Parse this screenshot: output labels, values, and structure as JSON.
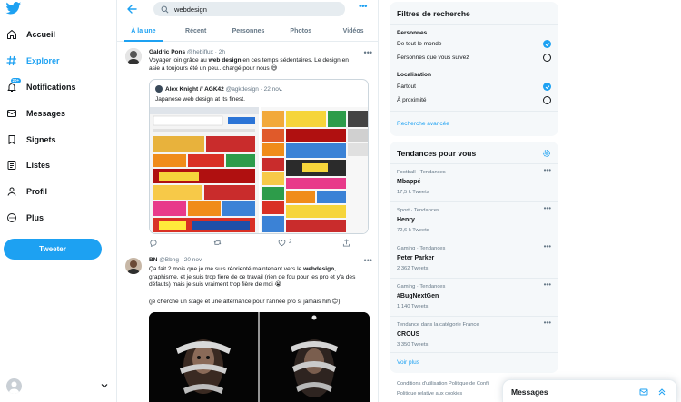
{
  "nav": {
    "items": [
      {
        "label": "Accueil",
        "icon": "home-icon"
      },
      {
        "label": "Explorer",
        "icon": "hash-icon"
      },
      {
        "label": "Notifications",
        "icon": "bell-icon",
        "badge": "20+"
      },
      {
        "label": "Messages",
        "icon": "envelope-icon"
      },
      {
        "label": "Signets",
        "icon": "bookmark-icon"
      },
      {
        "label": "Listes",
        "icon": "list-icon"
      },
      {
        "label": "Profil",
        "icon": "user-icon"
      },
      {
        "label": "Plus",
        "icon": "more-circle-icon"
      }
    ],
    "tweet_button": "Tweeter"
  },
  "search": {
    "value": "webdesign"
  },
  "tabs": [
    "À la une",
    "Récent",
    "Personnes",
    "Photos",
    "Vidéos"
  ],
  "tweets": [
    {
      "name": "Galdric Pons",
      "meta": "@hebiflux · 2h",
      "text_parts": [
        "Voyager loin grâce au ",
        "web design",
        " en ces temps sédentaires. Le design en asie a toujours été un peu.. chargé pour nous 😅"
      ],
      "quote": {
        "name": "Alex Knight // AGK42",
        "meta": "@agkdesign · 22 nov.",
        "text": "Japanese web design at its finest."
      },
      "actions": {
        "reply": "",
        "retweet": "",
        "like": "2"
      }
    },
    {
      "name": "BN",
      "meta": "@Bbng · 20 nov.",
      "text_parts": [
        "Ça fait 2 mois que je me suis réorienté maintenant vers le ",
        "webdesign",
        ", graphisme, et je suis trop fière de ce travail (rien de fou pour les pro et y'a des défauts) mais je suis vraiment trop fière de moi 😭"
      ],
      "text2": "(je cherche un stage et une alternance pour l'année pro si jamais hihi😊)"
    }
  ],
  "filters": {
    "title": "Filtres de recherche",
    "people_title": "Personnes",
    "people": [
      {
        "label": "De tout le monde",
        "checked": true
      },
      {
        "label": "Personnes que vous suivez",
        "checked": false
      }
    ],
    "location_title": "Localisation",
    "location": [
      {
        "label": "Partout",
        "checked": true
      },
      {
        "label": "À proximité",
        "checked": false
      }
    ],
    "advanced": "Recherche avancée"
  },
  "trends": {
    "title": "Tendances pour vous",
    "items": [
      {
        "category": "Football · Tendances",
        "name": "Mbappé",
        "count": "17,5 k Tweets"
      },
      {
        "category": "Sport · Tendances",
        "name": "Henry",
        "count": "72,6 k Tweets"
      },
      {
        "category": "Gaming · Tendances",
        "name": "Peter Parker",
        "count": "2 362 Tweets"
      },
      {
        "category": "Gaming · Tendances",
        "name": "#BugNextGen",
        "count": "1 140 Tweets"
      },
      {
        "category": "Tendance dans la catégorie France",
        "name": "CROUS",
        "count": "3 350 Tweets"
      }
    ],
    "more": "Voir plus"
  },
  "footer": {
    "line1": "Conditions d'utilisation   Politique de Confi",
    "line2": "Politique relative aux cookies"
  },
  "messages": {
    "title": "Messages"
  },
  "colors": {
    "accent": "#1da1f2",
    "text": "#14171a",
    "muted": "#657786",
    "panel": "#f5f8fa",
    "border": "#e6ecf0"
  }
}
